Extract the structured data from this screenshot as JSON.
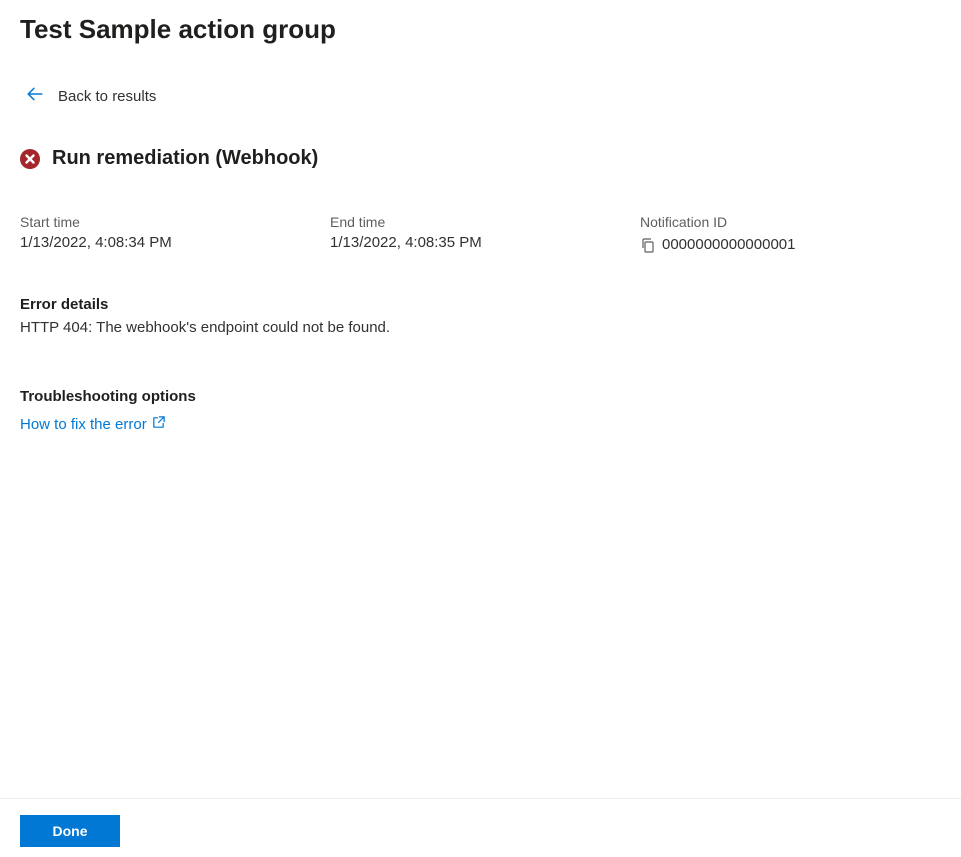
{
  "header": {
    "title": "Test Sample action group"
  },
  "back_link": {
    "label": "Back to results"
  },
  "status": {
    "icon": "error-circle",
    "label": "Run remediation (Webhook)"
  },
  "meta": {
    "start_time_label": "Start time",
    "start_time_value": "1/13/2022, 4:08:34 PM",
    "end_time_label": "End time",
    "end_time_value": "1/13/2022, 4:08:35 PM",
    "notification_id_label": "Notification ID",
    "notification_id_value": "0000000000000001"
  },
  "error_details": {
    "heading": "Error details",
    "message": "HTTP 404: The webhook's endpoint could not be found."
  },
  "troubleshooting": {
    "heading": "Troubleshooting options",
    "link_label": "How to fix the error"
  },
  "footer": {
    "done_label": "Done"
  },
  "colors": {
    "primary": "#0078d4",
    "error": "#a4262c"
  }
}
